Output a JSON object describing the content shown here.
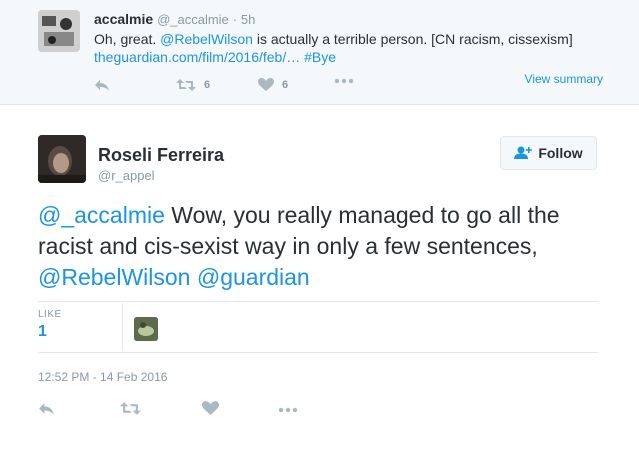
{
  "parent_tweet": {
    "name": "accalmie",
    "handle": "@_accalmie",
    "separator": "·",
    "time": "5h",
    "text_parts": {
      "t1": "Oh, great. ",
      "mention": "@RebelWilson",
      "t2": " is actually a terrible person. [CN racism, cissexism]"
    },
    "link": "theguardian.com/film/2016/feb/…",
    "hashtag": "#Bye",
    "view_summary": "View summary",
    "retweet_count": "6",
    "like_count": "6",
    "icons": [
      "reply-icon",
      "retweet-icon",
      "heart-icon",
      "more-icon"
    ]
  },
  "main_tweet": {
    "name": "Roseli Ferreira",
    "handle": "@r_appel",
    "follow_label": "Follow",
    "text_parts": {
      "m1": "@_accalmie",
      "t1": " Wow, you really managed to go all the racist and cis-sexist way in only a few sentences, ",
      "m2": "@RebelWilson",
      "t2": " ",
      "m3": "@guardian"
    },
    "stats": {
      "like_label": "LIKE",
      "like_value": "1"
    },
    "timestamp": "12:52 PM - 14 Feb 2016",
    "icons": [
      "reply-icon",
      "retweet-icon",
      "heart-icon",
      "more-icon"
    ]
  },
  "colors": {
    "link": "#1b95e0",
    "text": "#292f33",
    "muted": "#8899a6",
    "icon": "#aab8c2",
    "parent_bg": "#f5f8fa"
  }
}
